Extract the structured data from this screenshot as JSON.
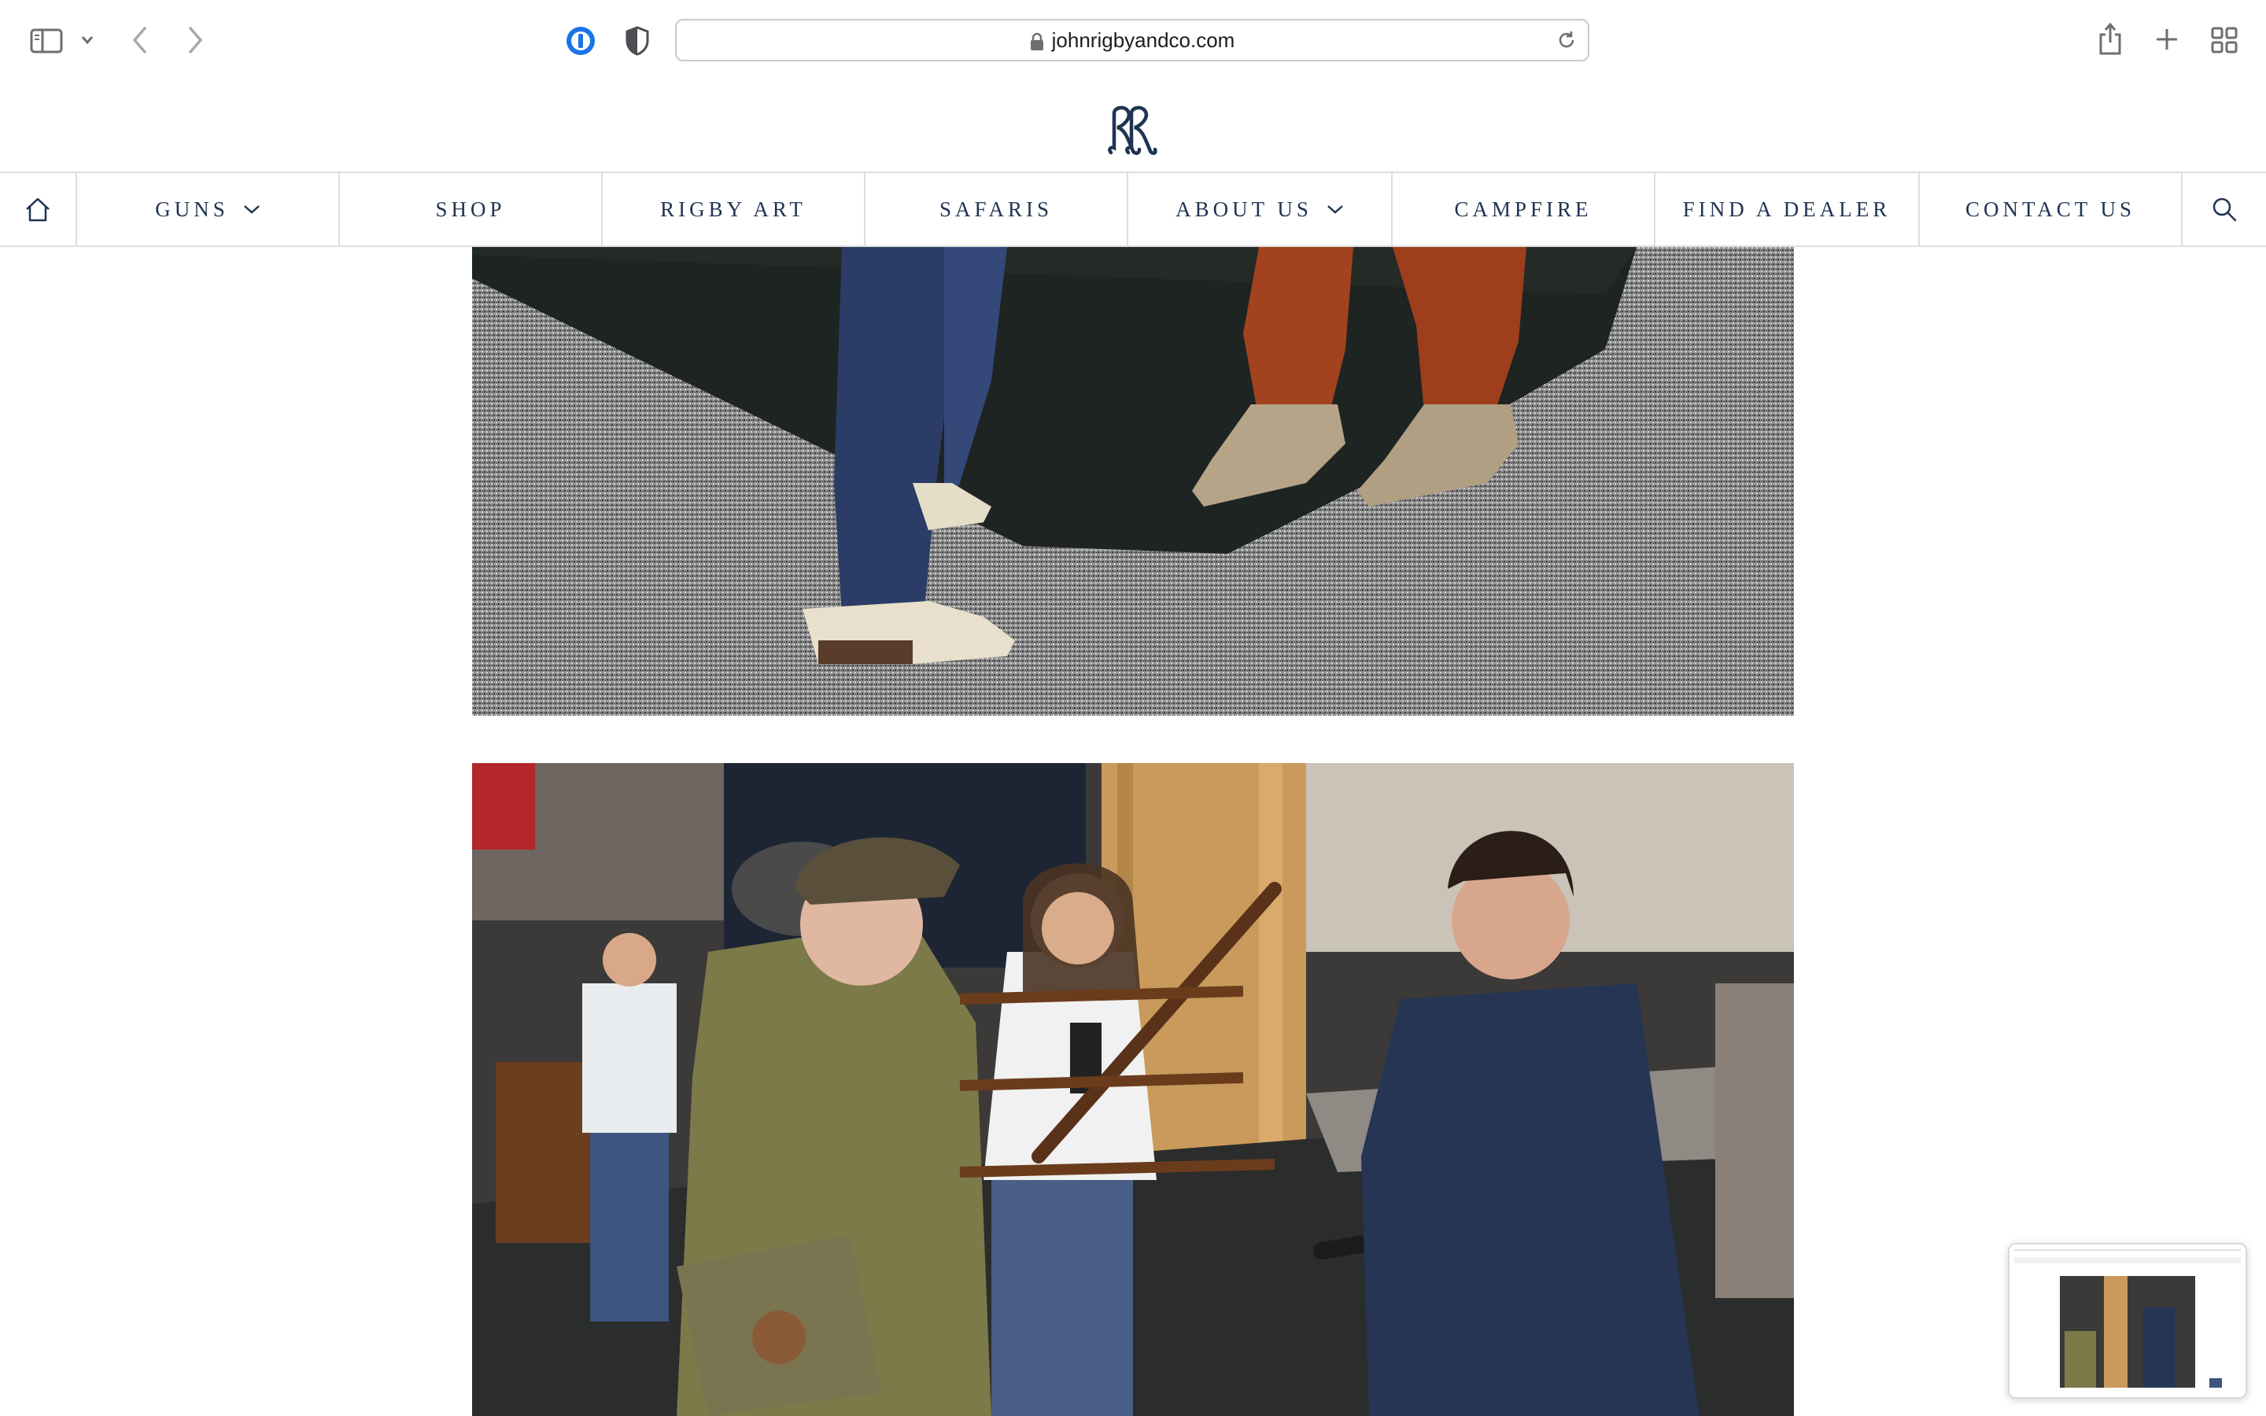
{
  "browser": {
    "url": "johnrigbyandco.com",
    "icons": {
      "sidebar": "sidebar-icon",
      "chevron": "chevron-down-icon",
      "back": "back-arrow-icon",
      "forward": "forward-arrow-icon",
      "password": "password-manager-icon",
      "shield": "privacy-shield-icon",
      "lock": "lock-icon",
      "reload": "reload-icon",
      "share": "share-icon",
      "new_tab": "plus-icon",
      "tabs": "tab-overview-icon"
    }
  },
  "site": {
    "logo": "rigby-monogram-logo",
    "brand_color": "#1f3352",
    "nav": {
      "items": [
        {
          "label": "GUNS",
          "has_dropdown": true
        },
        {
          "label": "SHOP",
          "has_dropdown": false
        },
        {
          "label": "RIGBY ART",
          "has_dropdown": false
        },
        {
          "label": "SAFARIS",
          "has_dropdown": false
        },
        {
          "label": "ABOUT US",
          "has_dropdown": true
        },
        {
          "label": "CAMPFIRE",
          "has_dropdown": false
        },
        {
          "label": "FIND A DEALER",
          "has_dropdown": false
        },
        {
          "label": "CONTACT US",
          "has_dropdown": false
        }
      ]
    }
  },
  "content": {
    "photos": [
      "boots-on-carpet-photo",
      "gun-show-booth-photo"
    ]
  }
}
